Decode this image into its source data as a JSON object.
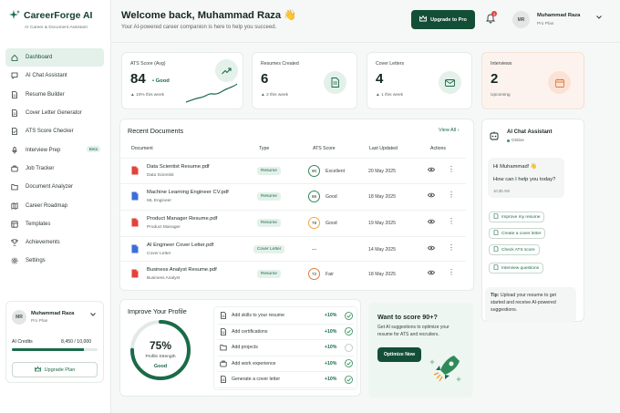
{
  "brand": {
    "name": "CareerForge AI",
    "tagline": "AI Career & Document Assistant"
  },
  "nav": [
    {
      "label": "Dashboard",
      "icon": "home-icon",
      "active": true
    },
    {
      "label": "AI Chat Assistant",
      "icon": "chat-icon"
    },
    {
      "label": "Resume Builder",
      "icon": "document-icon"
    },
    {
      "label": "Cover Letter Generator",
      "icon": "document-icon"
    },
    {
      "label": "ATS Score Checker",
      "icon": "check-document-icon"
    },
    {
      "label": "Interview Prep",
      "icon": "microphone-icon",
      "badge": "Beta"
    },
    {
      "label": "Job Tracker",
      "icon": "briefcase-icon"
    },
    {
      "label": "Document Analyzer",
      "icon": "folder-icon"
    },
    {
      "label": "Career Roadmap",
      "icon": "map-icon"
    },
    {
      "label": "Templates",
      "icon": "template-icon"
    },
    {
      "label": "Achievements",
      "icon": "trophy-icon"
    },
    {
      "label": "Settings",
      "icon": "gear-icon"
    }
  ],
  "sidebar_user": {
    "initials": "MR",
    "name": "Muhammad Raza",
    "plan": "Pro Plan",
    "credits_label": "AI Credits",
    "credits_value": "8,450 / 10,000",
    "credits_fraction": 0.845,
    "upgrade_label": "Upgrade Plan"
  },
  "header": {
    "welcome": "Welcome back, Muhammad Raza 👋",
    "subtitle": "Your AI-powered career companion is here to help you succeed.",
    "upgrade_label": "Upgrade to Pro",
    "notification_count": "3",
    "initials": "MR",
    "name": "Muhammad Raza",
    "plan": "Pro Plan"
  },
  "stats": [
    {
      "title": "ATS Score (Avg)",
      "value": "84",
      "value_suffix": "• Good",
      "note": "▲ 10% this week",
      "icon": "trend-up-icon"
    },
    {
      "title": "Resumes Created",
      "value": "6",
      "note": "▲ 2 this week",
      "icon": "document-icon"
    },
    {
      "title": "Cover Letters",
      "value": "4",
      "note": "▲ 1 this week",
      "icon": "mail-icon"
    },
    {
      "title": "Interviews",
      "value": "2",
      "note": "Upcoming",
      "icon": "calendar-icon"
    }
  ],
  "recent_documents": {
    "title": "Recent Documents",
    "view_all": "View All",
    "columns": [
      "Document",
      "Type",
      "ATS Score",
      "Last Updated",
      "Actions"
    ],
    "rows": [
      {
        "name": "Data Scientist Resume.pdf",
        "sub": "Data Scientist",
        "type": "Resume",
        "score": "90",
        "score_label": "Excellent",
        "date": "20 May 2025",
        "file": "pdf"
      },
      {
        "name": "Machine Learning Engineer CV.pdf",
        "sub": "ML Engineer",
        "type": "Resume",
        "score": "86",
        "score_label": "Good",
        "date": "18 May 2025",
        "file": "doc"
      },
      {
        "name": "Product Manager Resume.pdf",
        "sub": "Product Manager",
        "type": "Resume",
        "score": "78",
        "score_label": "Good",
        "date": "19 May 2025",
        "file": "pdf"
      },
      {
        "name": "AI Engineer Cover Letter.pdf",
        "sub": "Cover Letter",
        "type": "Cover Letter",
        "score": "",
        "score_label": "—",
        "date": "14 May 2025",
        "file": "doc"
      },
      {
        "name": "Business Analyst Resume.pdf",
        "sub": "Business Analyst",
        "type": "Resume",
        "score": "72",
        "score_label": "Fair",
        "date": "18 May 2025",
        "file": "pdf"
      }
    ]
  },
  "chat": {
    "title": "AI Chat Assistant",
    "status": "Online",
    "greeting": "Hi Muhammad! 👋",
    "message": "How can I help you today?",
    "time": "10:30 AM",
    "suggestions": [
      "Improve my resume",
      "Create a cover letter",
      "Check ATS score",
      "Interview questions"
    ],
    "tip_label": "Tip:",
    "tip_text": " Upload your resume to get started and receive AI-powered suggestions."
  },
  "profile": {
    "title": "Improve Your Profile",
    "percent": "75%",
    "percent_value": 0.75,
    "strength_label": "Profile Strength",
    "strength_value": "Good",
    "tasks": [
      {
        "label": "Add skills to your resume",
        "gain": "+10%",
        "done": true
      },
      {
        "label": "Add certifications",
        "gain": "+10%",
        "done": true
      },
      {
        "label": "Add projects",
        "gain": "+10%",
        "done": false
      },
      {
        "label": "Add work experience",
        "gain": "+10%",
        "done": true
      },
      {
        "label": "Generate a cover letter",
        "gain": "+10%",
        "done": true
      }
    ]
  },
  "cta": {
    "title": "Want to score 90+?",
    "text": "Get AI suggestions to optimize your resume for ATS and recruiters.",
    "button": "Optimize Now"
  },
  "colors": {
    "brand": "#134f36",
    "accent": "#1a6b47",
    "warning": "#f0a63a",
    "danger": "#e2433a"
  }
}
